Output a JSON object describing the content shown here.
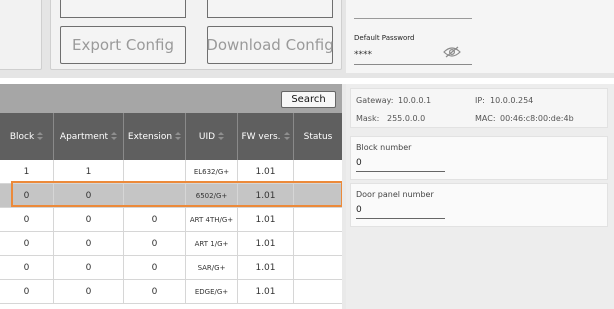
{
  "toolbar": {
    "export_config_label": "Export Config",
    "download_config_label": "Download Config"
  },
  "password": {
    "label": "Default Password",
    "value": "****",
    "toggle_icon": "eye-icon"
  },
  "table": {
    "search_label": "Search",
    "columns": [
      "Block",
      "Apartment",
      "Extension",
      "UID",
      "FW vers.",
      "Status"
    ],
    "rows": [
      {
        "block": "1",
        "apartment": "1",
        "extension": "",
        "uid": "EL632/G+",
        "fw": "1.01",
        "status": ""
      },
      {
        "block": "0",
        "apartment": "0",
        "extension": "",
        "uid": "6502/G+",
        "fw": "1.01",
        "status": ""
      },
      {
        "block": "0",
        "apartment": "0",
        "extension": "0",
        "uid": "ART 4TH/G+",
        "fw": "1.01",
        "status": ""
      },
      {
        "block": "0",
        "apartment": "0",
        "extension": "0",
        "uid": "ART 1/G+",
        "fw": "1.01",
        "status": ""
      },
      {
        "block": "0",
        "apartment": "0",
        "extension": "0",
        "uid": "SAR/G+",
        "fw": "1.01",
        "status": ""
      },
      {
        "block": "0",
        "apartment": "0",
        "extension": "0",
        "uid": "EDGE/G+",
        "fw": "1.01",
        "status": ""
      }
    ],
    "selected_row": 1
  },
  "device_info": {
    "gateway_label": "Gateway:",
    "gateway": "10.0.0.1",
    "ip_label": "IP:",
    "ip": "10.0.0.254",
    "mask_label": "Mask:",
    "mask": "255.0.0.0",
    "mac_label": "MAC:",
    "mac": "00:46:c8:00:de:4b"
  },
  "block_number": {
    "label": "Block number",
    "value": "0"
  },
  "door_panel_number": {
    "label": "Door panel number",
    "value": "0"
  },
  "colors": {
    "accent_selection": "#ec8a3a",
    "header_dark": "#5f5f5f"
  }
}
